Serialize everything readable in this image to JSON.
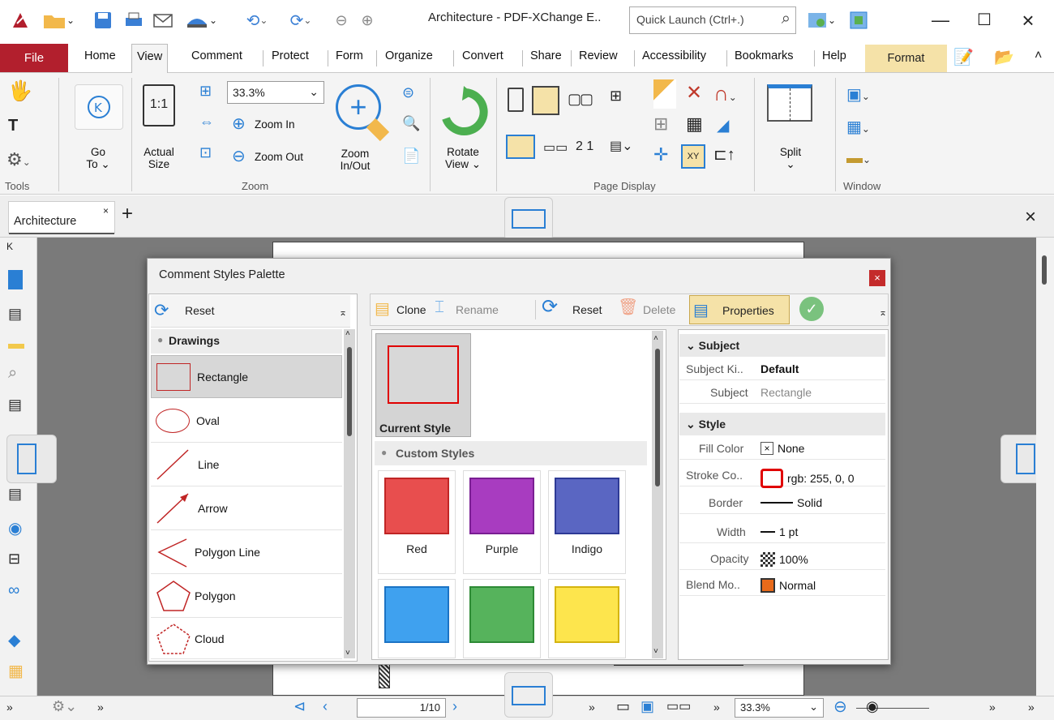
{
  "titlebar": {
    "title": "Architecture - PDF-XChange E..",
    "quick_launch_placeholder": "Quick Launch (Ctrl+.)",
    "min": "—",
    "max": "☐",
    "close": "×"
  },
  "menu": {
    "tabs": [
      "File",
      "Home",
      "View",
      "Comment",
      "Protect",
      "Form",
      "Organize",
      "Convert",
      "Share",
      "Review",
      "Accessibility",
      "Bookmarks",
      "Help",
      "Format"
    ],
    "active": "View"
  },
  "ribbon": {
    "tools": {
      "group": "Tools"
    },
    "goto": {
      "label1": "Go",
      "label2": "To ⌄"
    },
    "actual": {
      "label1": "Actual",
      "label2": "Size",
      "icon_text": "1:1"
    },
    "zoom_value": "33.3%",
    "zoom_in": "Zoom In",
    "zoom_out": "Zoom Out",
    "zoom_inout1": "Zoom",
    "zoom_inout2": "In/Out",
    "zoom_group": "Zoom",
    "rotate1": "Rotate",
    "rotate2": "View ⌄",
    "page_display_group": "Page Display",
    "split": "Split",
    "window_group": "Window"
  },
  "doc": {
    "tab": "Architecture",
    "page_field": "1/10",
    "zoom_status": "33.3%"
  },
  "dialog": {
    "title": "Comment Styles Palette",
    "left_reset": "Reset",
    "category": "Drawings",
    "items": [
      "Rectangle",
      "Oval",
      "Line",
      "Arrow",
      "Polygon Line",
      "Polygon",
      "Cloud"
    ],
    "toolbar": {
      "clone": "Clone",
      "rename": "Rename",
      "reset": "Reset",
      "delete": "Delete",
      "properties": "Properties"
    },
    "current_style": "Current Style",
    "custom_styles": "Custom Styles",
    "swatches": [
      {
        "name": "Red",
        "color": "#e84e4e",
        "border": "#c02525"
      },
      {
        "name": "Purple",
        "color": "#a83cc0",
        "border": "#7a1e93"
      },
      {
        "name": "Indigo",
        "color": "#5a66c2",
        "border": "#2e3a96"
      },
      {
        "name": "",
        "color": "#3fa1ef",
        "border": "#1b73c4"
      },
      {
        "name": "",
        "color": "#56b35c",
        "border": "#2d8a35"
      },
      {
        "name": "",
        "color": "#fde54d",
        "border": "#d4b40f"
      }
    ],
    "props": {
      "subject_section": "Subject",
      "subject_kind_label": "Subject Ki..",
      "subject_kind_value": "Default",
      "subject_label": "Subject",
      "subject_value": "Rectangle",
      "style_section": "Style",
      "fill_label": "Fill Color",
      "fill_value": "None",
      "stroke_label": "Stroke Co..",
      "stroke_value": "rgb: 255, 0, 0",
      "border_label": "Border",
      "border_value": "Solid",
      "width_label": "Width",
      "width_value": "1 pt",
      "opacity_label": "Opacity",
      "opacity_value": "100%",
      "blend_label": "Blend Mo..",
      "blend_value": "Normal"
    }
  },
  "colors": {
    "file_red": "#b21f2d",
    "format_tab": "#f5e2a8",
    "accent_blue": "#2a7fd4"
  }
}
